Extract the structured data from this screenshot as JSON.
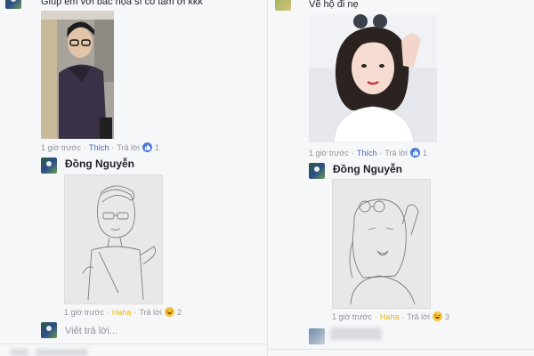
{
  "left": {
    "top_comment": "Giúp em với bác họa sĩ có tâm ơi kkk",
    "post_meta": {
      "time": "1 giờ trước",
      "action": "Thích",
      "reply": "Trả lời",
      "reaction": "like-reaction-icon",
      "count": "1"
    },
    "reply": {
      "author": "Đồng Nguyễn",
      "meta": {
        "time": "1 giờ trước",
        "action": "Haha",
        "reply": "Trả lời",
        "reaction": "haha-reaction-icon",
        "count": "2"
      }
    },
    "reply_placeholder": "Viết trả lời..."
  },
  "right": {
    "top_comment": "Vẽ hộ đi nẹ",
    "post_meta": {
      "time": "1 giờ trước",
      "action": "Thích",
      "reply": "Trả lời",
      "reaction": "like-reaction-icon",
      "count": "1"
    },
    "reply": {
      "author": "Đồng Nguyễn",
      "meta": {
        "time": "1 giờ trước",
        "action": "Haha",
        "reply": "Trả lời",
        "reaction": "haha-reaction-icon",
        "count": "3"
      }
    }
  },
  "colors": {
    "link": "#4267b2",
    "haha": "#f2b600",
    "meta": "#90949c",
    "like": "#4c7bd9"
  }
}
